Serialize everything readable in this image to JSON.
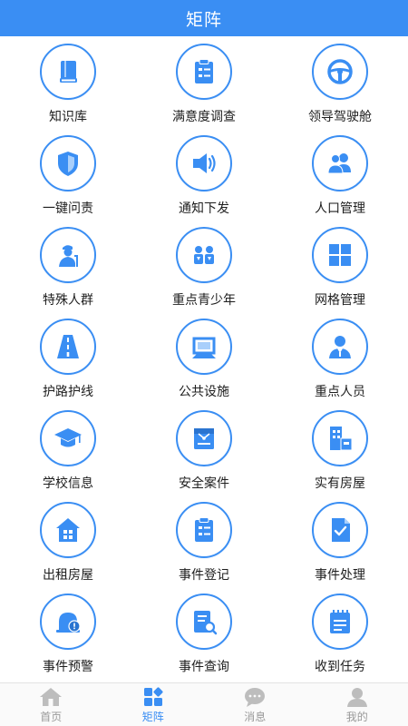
{
  "header": {
    "title": "矩阵"
  },
  "colors": {
    "accent": "#3a8ef3",
    "inactive": "#bdbdbd"
  },
  "grid": {
    "items": [
      {
        "label": "知识库",
        "icon": "book-icon"
      },
      {
        "label": "满意度调查",
        "icon": "clipboard-icon"
      },
      {
        "label": "领导驾驶舱",
        "icon": "steering-wheel-icon"
      },
      {
        "label": "一键问责",
        "icon": "shield-icon"
      },
      {
        "label": "通知下发",
        "icon": "speaker-icon"
      },
      {
        "label": "人口管理",
        "icon": "people-icon"
      },
      {
        "label": "特殊人群",
        "icon": "elderly-icon"
      },
      {
        "label": "重点青少年",
        "icon": "teenagers-icon"
      },
      {
        "label": "网格管理",
        "icon": "grid-icon"
      },
      {
        "label": "护路护线",
        "icon": "road-icon"
      },
      {
        "label": "公共设施",
        "icon": "facility-icon"
      },
      {
        "label": "重点人员",
        "icon": "person-icon"
      },
      {
        "label": "学校信息",
        "icon": "graduation-cap-icon"
      },
      {
        "label": "安全案件",
        "icon": "case-icon"
      },
      {
        "label": "实有房屋",
        "icon": "building-icon"
      },
      {
        "label": "出租房屋",
        "icon": "house-icon"
      },
      {
        "label": "事件登记",
        "icon": "register-icon"
      },
      {
        "label": "事件处理",
        "icon": "document-check-icon"
      },
      {
        "label": "事件预警",
        "icon": "alarm-icon"
      },
      {
        "label": "事件查询",
        "icon": "search-document-icon"
      },
      {
        "label": "收到任务",
        "icon": "task-icon"
      }
    ]
  },
  "tabbar": {
    "tabs": [
      {
        "label": "首页",
        "icon": "home-icon",
        "active": false
      },
      {
        "label": "矩阵",
        "icon": "matrix-icon",
        "active": true
      },
      {
        "label": "消息",
        "icon": "message-icon",
        "active": false
      },
      {
        "label": "我的",
        "icon": "user-icon",
        "active": false
      }
    ]
  }
}
